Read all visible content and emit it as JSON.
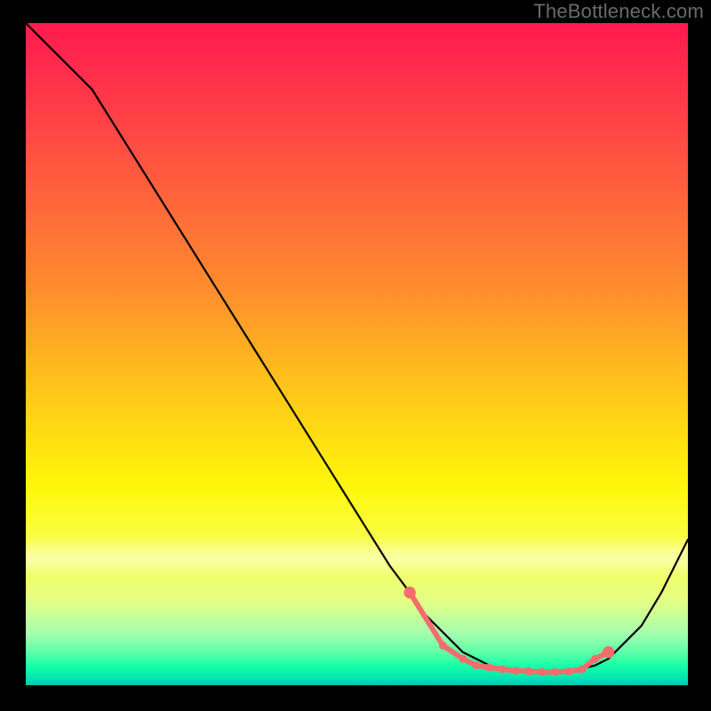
{
  "watermark": "TheBottleneck.com",
  "colors": {
    "page_bg": "#000000",
    "curve": "#000000",
    "marker": "#f36d6d"
  },
  "chart_data": {
    "type": "line",
    "title": "",
    "xlabel": "",
    "ylabel": "",
    "xlim": [
      0,
      100
    ],
    "ylim": [
      0,
      100
    ],
    "grid": false,
    "legend": false,
    "series": [
      {
        "name": "curve",
        "x": [
          0,
          6,
          10,
          15,
          20,
          25,
          30,
          35,
          40,
          45,
          50,
          55,
          58,
          60,
          63,
          66,
          70,
          74,
          78,
          82,
          86,
          88,
          90,
          93,
          96,
          100
        ],
        "y": [
          100,
          94,
          90,
          82,
          74,
          66,
          58,
          50,
          42,
          34,
          26,
          18,
          14,
          11,
          8,
          5,
          3,
          2,
          2,
          2,
          3,
          4,
          6,
          9,
          14,
          22
        ]
      }
    ],
    "markers": {
      "name": "highlighted-points",
      "x": [
        58,
        63,
        66,
        68,
        70,
        72,
        74,
        76,
        78,
        80,
        82,
        84,
        86,
        88
      ],
      "y": [
        14,
        6,
        4,
        3,
        2.7,
        2.4,
        2.2,
        2.1,
        2.0,
        2.0,
        2.1,
        2.4,
        4,
        5
      ]
    }
  }
}
